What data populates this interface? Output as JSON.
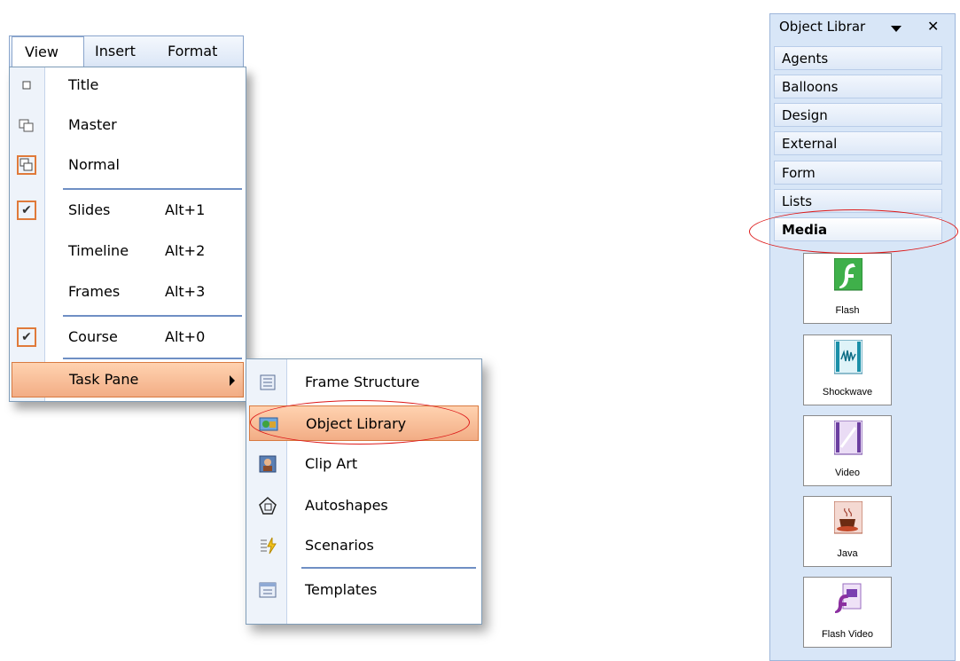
{
  "menubar": {
    "view": "View",
    "insert": "Insert",
    "format": "Format"
  },
  "view_menu": {
    "items": [
      {
        "label": "Title",
        "shortcut": ""
      },
      {
        "label": "Master",
        "shortcut": ""
      },
      {
        "label": "Normal",
        "shortcut": ""
      },
      {
        "label": "Slides",
        "shortcut": "Alt+1"
      },
      {
        "label": "Timeline",
        "shortcut": "Alt+2"
      },
      {
        "label": "Frames",
        "shortcut": "Alt+3"
      },
      {
        "label": "Course",
        "shortcut": "Alt+0"
      },
      {
        "label": "Task Pane",
        "shortcut": ""
      }
    ]
  },
  "task_pane_submenu": {
    "items": [
      {
        "label": "Frame Structure"
      },
      {
        "label": "Object Library"
      },
      {
        "label": "Clip Art"
      },
      {
        "label": "Autoshapes"
      },
      {
        "label": "Scenarios"
      },
      {
        "label": "Templates"
      }
    ]
  },
  "object_library": {
    "title": "Object Librar",
    "close": "✕",
    "categories": [
      "Agents",
      "Balloons",
      "Design",
      "External",
      "Form",
      "Lists",
      "Media"
    ],
    "selected_category": "Media",
    "media_items": [
      {
        "label": "Flash",
        "icon": "flash-icon"
      },
      {
        "label": "Shockwave",
        "icon": "shockwave-icon"
      },
      {
        "label": "Video",
        "icon": "video-icon"
      },
      {
        "label": "Java",
        "icon": "java-icon"
      },
      {
        "label": "Flash Video",
        "icon": "flash-video-icon"
      }
    ]
  },
  "colors": {
    "highlight": "#f2ad85",
    "highlight_border": "#d87a41",
    "annotation_ring": "#dd1a1a",
    "pane_bg": "#d8e6f7"
  }
}
